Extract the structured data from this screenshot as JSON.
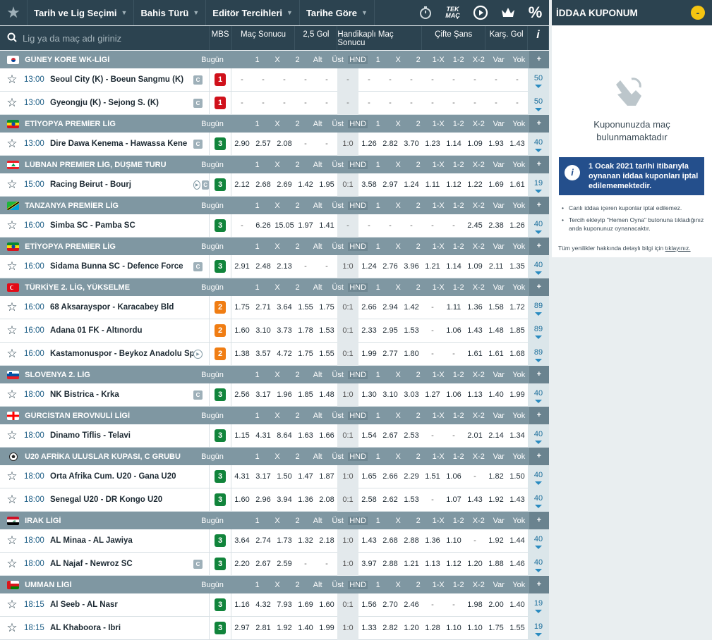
{
  "nav": {
    "menus": [
      "Tarih ve Lig Seçimi",
      "Bahis Türü",
      "Editör Tercihleri",
      "Tarihe Göre"
    ],
    "icons": [
      "stopwatch-icon",
      "tek-mac-icon",
      "play-icon",
      "crown-icon",
      "percent-icon"
    ],
    "tek_mac": "TEK MAÇ",
    "percent": "%"
  },
  "search": {
    "placeholder": "Lig ya da maç adı giriniz"
  },
  "headers": {
    "mbs": "MBS",
    "ms": "Maç Sonucu",
    "ou": "2,5 Gol",
    "hcap": "Handikaplı Maç Sonucu",
    "dc": "Çifte Şans",
    "btts": "Karş. Gol",
    "info": "i"
  },
  "colors": {
    "mbs1": "#d0111b",
    "mbs2": "#f07d13",
    "mbs3": "#11843b"
  },
  "league_cols": [
    "1",
    "X",
    "2",
    "Alt",
    "Üst",
    "HND",
    "1",
    "X",
    "2",
    "1-X",
    "1-2",
    "X-2",
    "Var",
    "Yok"
  ],
  "today_label": "Bugün",
  "plus": "+",
  "leagues": [
    {
      "name": "GÜNEY KORE WK-LİGİ",
      "flag": "kr",
      "hnd_col": "HND",
      "matches": [
        {
          "time": "13:00",
          "teams": "Seoul City (K) - Boeun Sangmu (K)",
          "c": true,
          "mbs": "1",
          "odds": [
            "-",
            "-",
            "-",
            "-",
            "-",
            "-",
            "-",
            "-",
            "-",
            "-",
            "-",
            "-",
            "-",
            "-"
          ],
          "more": "50"
        },
        {
          "time": "13:00",
          "teams": "Gyeongju (K) - Sejong S. (K)",
          "c": true,
          "mbs": "1",
          "odds": [
            "-",
            "-",
            "-",
            "-",
            "-",
            "-",
            "-",
            "-",
            "-",
            "-",
            "-",
            "-",
            "-",
            "-"
          ],
          "more": "50"
        }
      ]
    },
    {
      "name": "ETİYOPYA PREMİER LİG",
      "flag": "et",
      "hnd_col": "HND",
      "matches": [
        {
          "time": "13:00",
          "teams": "Dire Dawa Kenema - Hawassa Kene",
          "c": true,
          "mbs": "3",
          "odds": [
            "2.90",
            "2.57",
            "2.08",
            "-",
            "-",
            "1:0",
            "1.26",
            "2.82",
            "3.70",
            "1.23",
            "1.14",
            "1.09",
            "1.93",
            "1.43"
          ],
          "more": "40"
        }
      ]
    },
    {
      "name": "LÜBNAN PREMİER LİG, DÜŞME TURU",
      "flag": "lb",
      "hnd_col": "HND",
      "matches": [
        {
          "time": "15:00",
          "teams": "Racing Beirut - Bourj",
          "c": true,
          "play": true,
          "mbs": "3",
          "odds": [
            "2.12",
            "2.68",
            "2.69",
            "1.42",
            "1.95",
            "0:1",
            "3.58",
            "2.97",
            "1.24",
            "1.11",
            "1.12",
            "1.22",
            "1.69",
            "1.61"
          ],
          "more": "19"
        }
      ]
    },
    {
      "name": "TANZANYA PREMİER LİG",
      "flag": "tz",
      "hnd_col": "HND",
      "matches": [
        {
          "time": "16:00",
          "teams": "Simba SC - Pamba SC",
          "mbs": "3",
          "odds": [
            "-",
            "6.26",
            "15.05",
            "1.97",
            "1.41",
            "-",
            "-",
            "-",
            "-",
            "-",
            "-",
            "2.45",
            "2.38",
            "1.26"
          ],
          "more": "40"
        }
      ]
    },
    {
      "name": "ETİYOPYA PREMİER LİG",
      "flag": "et",
      "hnd_col": "HND",
      "matches": [
        {
          "time": "16:00",
          "teams": "Sidama Bunna SC - Defence Force",
          "c": true,
          "mbs": "3",
          "odds": [
            "2.91",
            "2.48",
            "2.13",
            "-",
            "-",
            "1:0",
            "1.24",
            "2.76",
            "3.96",
            "1.21",
            "1.14",
            "1.09",
            "2.11",
            "1.35"
          ],
          "more": "40"
        }
      ]
    },
    {
      "name": "TÜRKİYE 2. LİG, YÜKSELME",
      "flag": "tr",
      "hnd_col": "HND",
      "matches": [
        {
          "time": "16:00",
          "teams": "68 Aksarayspor - Karacabey Bld",
          "mbs": "2",
          "odds": [
            "1.75",
            "2.71",
            "3.64",
            "1.55",
            "1.75",
            "0:1",
            "2.66",
            "2.94",
            "1.42",
            "-",
            "1.11",
            "1.36",
            "1.58",
            "1.72"
          ],
          "more": "89"
        },
        {
          "time": "16:00",
          "teams": "Adana 01 FK - Altınordu",
          "mbs": "2",
          "odds": [
            "1.60",
            "3.10",
            "3.73",
            "1.78",
            "1.53",
            "0:1",
            "2.33",
            "2.95",
            "1.53",
            "-",
            "1.06",
            "1.43",
            "1.48",
            "1.85"
          ],
          "more": "89"
        },
        {
          "time": "16:00",
          "teams": "Kastamonuspor - Beykoz Anadolu Spor",
          "play": true,
          "mbs": "2",
          "odds": [
            "1.38",
            "3.57",
            "4.72",
            "1.75",
            "1.55",
            "0:1",
            "1.99",
            "2.77",
            "1.80",
            "-",
            "-",
            "1.61",
            "1.61",
            "1.68"
          ],
          "more": "89"
        }
      ]
    },
    {
      "name": "SLOVENYA 2. LİG",
      "flag": "si",
      "hnd_col": "HND",
      "matches": [
        {
          "time": "18:00",
          "teams": "NK Bistrica - Krka",
          "c": true,
          "mbs": "3",
          "odds": [
            "2.56",
            "3.17",
            "1.96",
            "1.85",
            "1.48",
            "1:0",
            "1.30",
            "3.10",
            "3.03",
            "1.27",
            "1.06",
            "1.13",
            "1.40",
            "1.99"
          ],
          "more": "40"
        }
      ]
    },
    {
      "name": "GÜRCİSTAN EROVNULİ LİGİ",
      "flag": "ge",
      "hnd_col": "HND",
      "matches": [
        {
          "time": "18:00",
          "teams": "Dinamo Tiflis - Telavi",
          "mbs": "3",
          "odds": [
            "1.15",
            "4.31",
            "8.64",
            "1.63",
            "1.66",
            "0:1",
            "1.54",
            "2.67",
            "2.53",
            "-",
            "-",
            "2.01",
            "2.14",
            "1.34"
          ],
          "more": "40"
        }
      ]
    },
    {
      "name": "U20 AFRİKA ULUSLAR KUPASI, C GRUBU",
      "flag": "ball",
      "hnd_col": "HND",
      "matches": [
        {
          "time": "18:00",
          "teams": "Orta Afrika Cum. U20 - Gana U20",
          "mbs": "3",
          "odds": [
            "4.31",
            "3.17",
            "1.50",
            "1.47",
            "1.87",
            "1:0",
            "1.65",
            "2.66",
            "2.29",
            "1.51",
            "1.06",
            "-",
            "1.82",
            "1.50"
          ],
          "more": "40"
        },
        {
          "time": "18:00",
          "teams": "Senegal U20 - DR Kongo U20",
          "mbs": "3",
          "odds": [
            "1.60",
            "2.96",
            "3.94",
            "1.36",
            "2.08",
            "0:1",
            "2.58",
            "2.62",
            "1.53",
            "-",
            "1.07",
            "1.43",
            "1.92",
            "1.43"
          ],
          "more": "40"
        }
      ]
    },
    {
      "name": "IRAK LİGİ",
      "flag": "iq",
      "hnd_col": "HND",
      "matches": [
        {
          "time": "18:00",
          "teams": "AL Minaa - AL Jawiya",
          "mbs": "3",
          "odds": [
            "3.64",
            "2.74",
            "1.73",
            "1.32",
            "2.18",
            "1:0",
            "1.43",
            "2.68",
            "2.88",
            "1.36",
            "1.10",
            "-",
            "1.92",
            "1.44"
          ],
          "more": "40"
        },
        {
          "time": "18:00",
          "teams": "AL Najaf - Newroz SC",
          "c": true,
          "mbs": "3",
          "odds": [
            "2.20",
            "2.67",
            "2.59",
            "-",
            "-",
            "1:0",
            "3.97",
            "2.88",
            "1.21",
            "1.13",
            "1.12",
            "1.20",
            "1.88",
            "1.46"
          ],
          "more": "40"
        }
      ]
    },
    {
      "name": "UMMAN LİGİ",
      "flag": "om",
      "hnd_col": "HND",
      "matches": [
        {
          "time": "18:15",
          "teams": "Al Seeb - AL Nasr",
          "mbs": "3",
          "odds": [
            "1.16",
            "4.32",
            "7.93",
            "1.69",
            "1.60",
            "0:1",
            "1.56",
            "2.70",
            "2.46",
            "-",
            "-",
            "1.98",
            "2.00",
            "1.40"
          ],
          "more": "19"
        },
        {
          "time": "18:15",
          "teams": "AL Khaboora - Ibri",
          "mbs": "3",
          "odds": [
            "2.97",
            "2.81",
            "1.92",
            "1.40",
            "1.99",
            "1:0",
            "1.33",
            "2.82",
            "1.20",
            "1.28",
            "1.10",
            "1.10",
            "1.75",
            "1.55"
          ],
          "more": "19"
        }
      ]
    }
  ],
  "coupon": {
    "title": "İDDAA KUPONUM",
    "minus": "-",
    "empty": "Kuponunuzda maç bulunmamaktadır",
    "info_icon": "i",
    "info": "1 Ocak 2021 tarihi itibarıyla oynanan iddaa kuponları iptal edilememektedir.",
    "bullets": [
      "Canlı iddaa içeren kuponlar iptal edilemez.",
      "Tercih ekleyip \"Hemen Oyna\" butonuna tıkladığınız anda kuponunuz oynanacaktır."
    ],
    "footer": "Tüm yenilikler hakkında detaylı bilgi için",
    "footer_link": "tıklayınız."
  }
}
